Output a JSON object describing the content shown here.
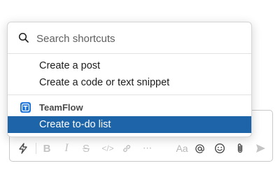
{
  "search": {
    "placeholder": "Search shortcuts"
  },
  "items": [
    {
      "label": "Create a post"
    },
    {
      "label": "Create a code or text snippet"
    }
  ],
  "app_section": {
    "name": "TeamFlow",
    "icon": "teamflow-logo-icon",
    "color": "#1a73d9",
    "items": [
      {
        "label": "Create to-do list",
        "selected": true
      }
    ]
  },
  "toolbar": {
    "left_icon": "lightning-bolt-icon",
    "format_icons": [
      "bold-icon",
      "italic-icon",
      "strikethrough-icon",
      "code-icon",
      "link-icon",
      "more-icon"
    ],
    "text_style_label": "Aa",
    "right_icons": [
      "mention-icon",
      "emoji-icon",
      "attachment-icon",
      "send-icon"
    ]
  },
  "colors": {
    "selection": "#1e64a9",
    "accent": "#1a73d9"
  }
}
